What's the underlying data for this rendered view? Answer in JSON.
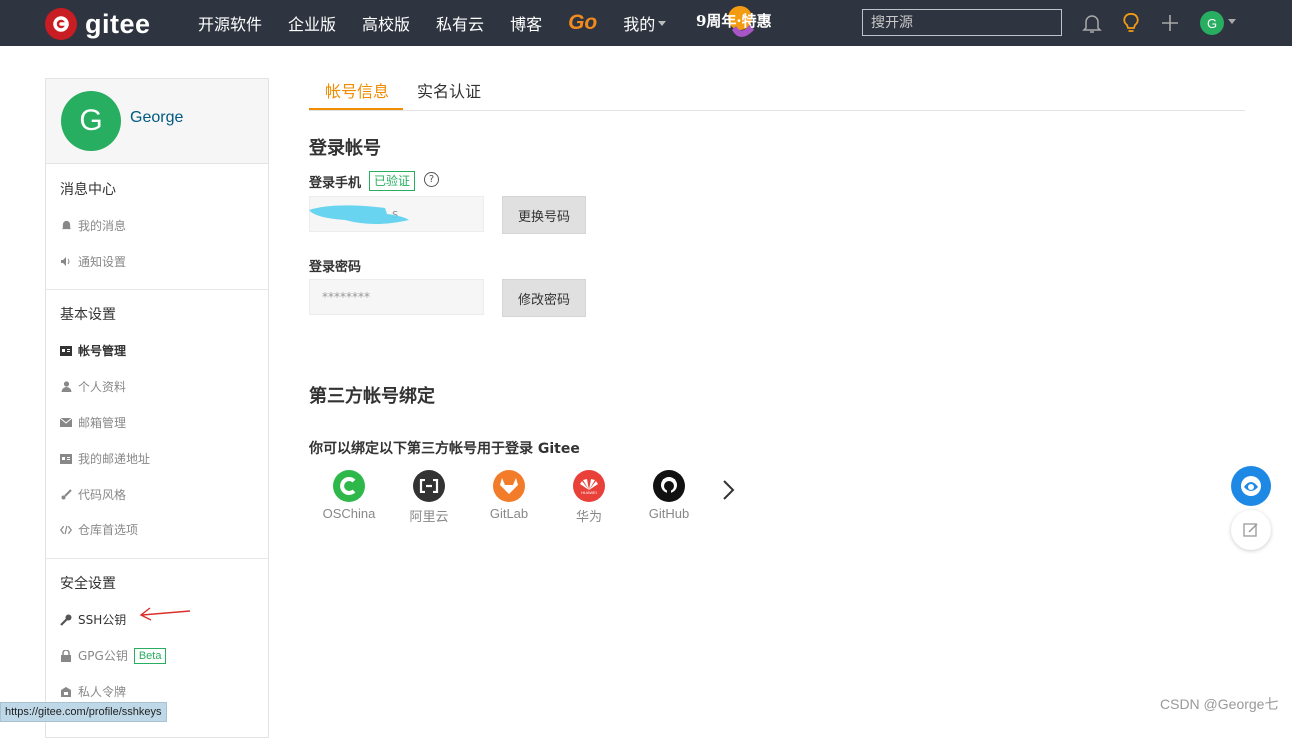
{
  "topbar": {
    "logo_text": "gitee",
    "nav": [
      "开源软件",
      "企业版",
      "高校版",
      "私有云",
      "博客"
    ],
    "go_label": "Go",
    "mine_label": "我的",
    "promo_text": "9周年·特惠",
    "search_placeholder": "搜开源",
    "avatar_letter": "G"
  },
  "sidebar": {
    "avatar_letter": "G",
    "username": "George",
    "sections": {
      "messages": {
        "title": "消息中心",
        "items": [
          "我的消息",
          "通知设置"
        ]
      },
      "basic": {
        "title": "基本设置",
        "items": [
          "帐号管理",
          "个人资料",
          "邮箱管理",
          "我的邮递地址",
          "代码风格",
          "仓库首选项"
        ]
      },
      "security": {
        "title": "安全设置",
        "items": [
          "SSH公钥",
          "GPG公钥",
          "私人令牌"
        ],
        "beta": "Beta"
      }
    }
  },
  "main": {
    "tabs": [
      "帐号信息",
      "实名认证"
    ],
    "login_account_title": "登录帐号",
    "phone_label": "登录手机",
    "verified_badge": "已验证",
    "help_icon": "?",
    "phone_value": "s",
    "change_phone_btn": "更换号码",
    "password_label": "登录密码",
    "password_value": "********",
    "change_password_btn": "修改密码",
    "third_party_title": "第三方帐号绑定",
    "third_party_sub": "你可以绑定以下第三方帐号用于登录 Gitee",
    "providers": [
      "OSChina",
      "阿里云",
      "GitLab",
      "华为",
      "GitHub"
    ],
    "huawei_logo_text": "HUAWEI"
  },
  "status_url": "https://gitee.com/profile/sshkeys",
  "watermark": "CSDN @George七"
}
